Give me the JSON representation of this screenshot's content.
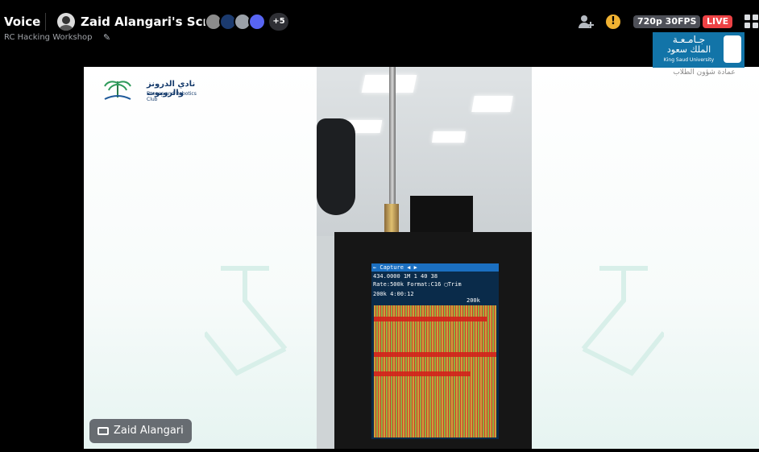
{
  "header": {
    "channel": "Voice",
    "screen_title": "Zaid Alangari's Screen",
    "viewers_more": "+5",
    "subtitle": "RC Hacking Workshop",
    "quality": "720p 30FPS",
    "live": "LIVE",
    "warning": "!"
  },
  "ksu": {
    "arabic_line1": "جـامـعـة",
    "arabic_line2": "الملك سعود",
    "english": "King Saud University",
    "caption": "عمادة شؤون الطلاب"
  },
  "club": {
    "arabic": "نادي الدرونز والروبوت",
    "english": "Drones and Robotics Club"
  },
  "device_screen": {
    "row1": "← Capture  ◀ ▶",
    "row2": "434.0000   1M  1 40 38",
    "row3": "Rate:500k  Format:C16  ▢Trim",
    "row4": "200k              4:00:12",
    "row5": "200k"
  },
  "presenter": {
    "name": "Zaid Alangari"
  },
  "colors": {
    "live": "#ed4245",
    "ksu_blue": "#1274a8",
    "warning": "#f0b232"
  }
}
